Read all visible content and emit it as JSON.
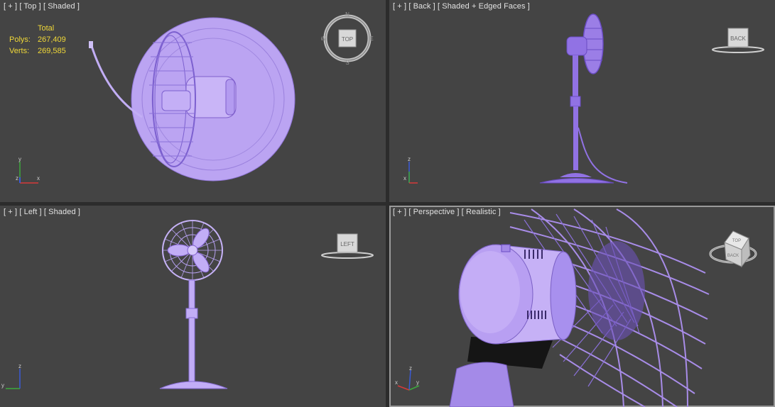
{
  "viewports": {
    "top": {
      "plus": "[ + ]",
      "view": "[ Top ]",
      "shading": "[ Shaded ]",
      "cube_label": "TOP",
      "compass": {
        "n": "N",
        "s": "S",
        "e": "E",
        "w": "W"
      }
    },
    "back": {
      "plus": "[ + ]",
      "view": "[ Back ]",
      "shading": "[ Shaded + Edged Faces ]",
      "cube_label": "BACK"
    },
    "left": {
      "plus": "[ + ]",
      "view": "[ Left ]",
      "shading": "[ Shaded ]",
      "cube_label": "LEFT"
    },
    "perspective": {
      "plus": "[ + ]",
      "view": "[ Perspective ]",
      "shading": "[ Realistic ]",
      "cube_top": "TOP",
      "cube_front": "BACK"
    }
  },
  "stats": {
    "header": "Total",
    "polys_label": "Polys:",
    "polys_value": "267,409",
    "verts_label": "Verts:",
    "verts_value": "269,585"
  },
  "axes": {
    "x": "x",
    "y": "y",
    "z": "z"
  },
  "colors": {
    "viewport_bg": "#444444",
    "model": "#b59cf0",
    "model_dark": "#7a5fc4",
    "label_text": "#e2e2e2",
    "stats_text": "#f0d838"
  }
}
